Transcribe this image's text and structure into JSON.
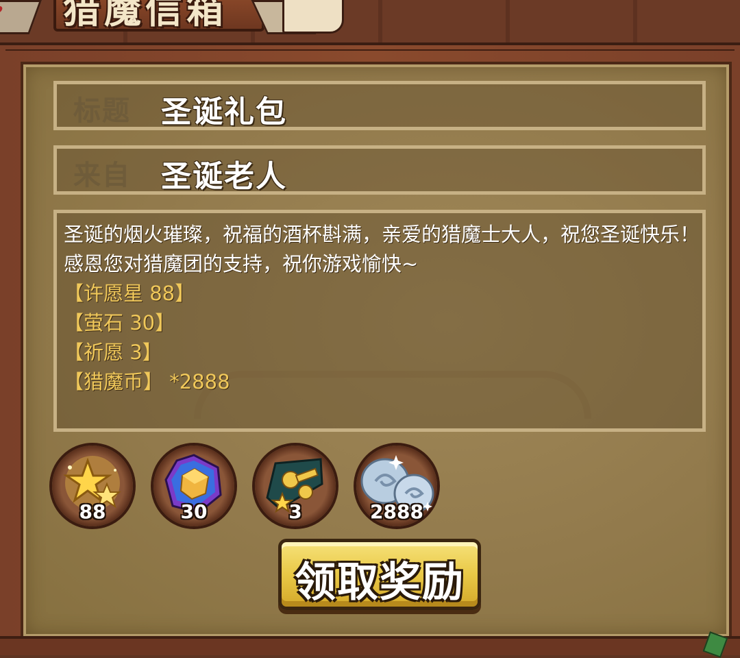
{
  "header": {
    "title": "猎魔信箱"
  },
  "mail": {
    "title_label": "标题",
    "title_value": "圣诞礼包",
    "from_label": "来自",
    "from_value": "圣诞老人",
    "body": "圣诞的烟火璀璨，祝福的酒杯斟满，亲爱的猎魔士大人，祝您圣诞快乐！感恩您对猎魔团的支持，祝你游戏愉快~",
    "items": [
      "【许愿星 88】",
      "【萤石 30】",
      "【祈愿 3】",
      "【猎魔币】 *2888"
    ]
  },
  "rewards": [
    {
      "icon": "wish-star-icon",
      "count": "88"
    },
    {
      "icon": "fluorite-gem-icon",
      "count": "30"
    },
    {
      "icon": "prayer-ticket-icon",
      "count": "3"
    },
    {
      "icon": "hunter-coin-icon",
      "count": "2888"
    }
  ],
  "claim_button": {
    "label": "领取奖励"
  },
  "colors": {
    "wood": "#7a4029",
    "parchment": "#927a4c",
    "item_text": "#f0c85a",
    "button": "#e9c846"
  }
}
